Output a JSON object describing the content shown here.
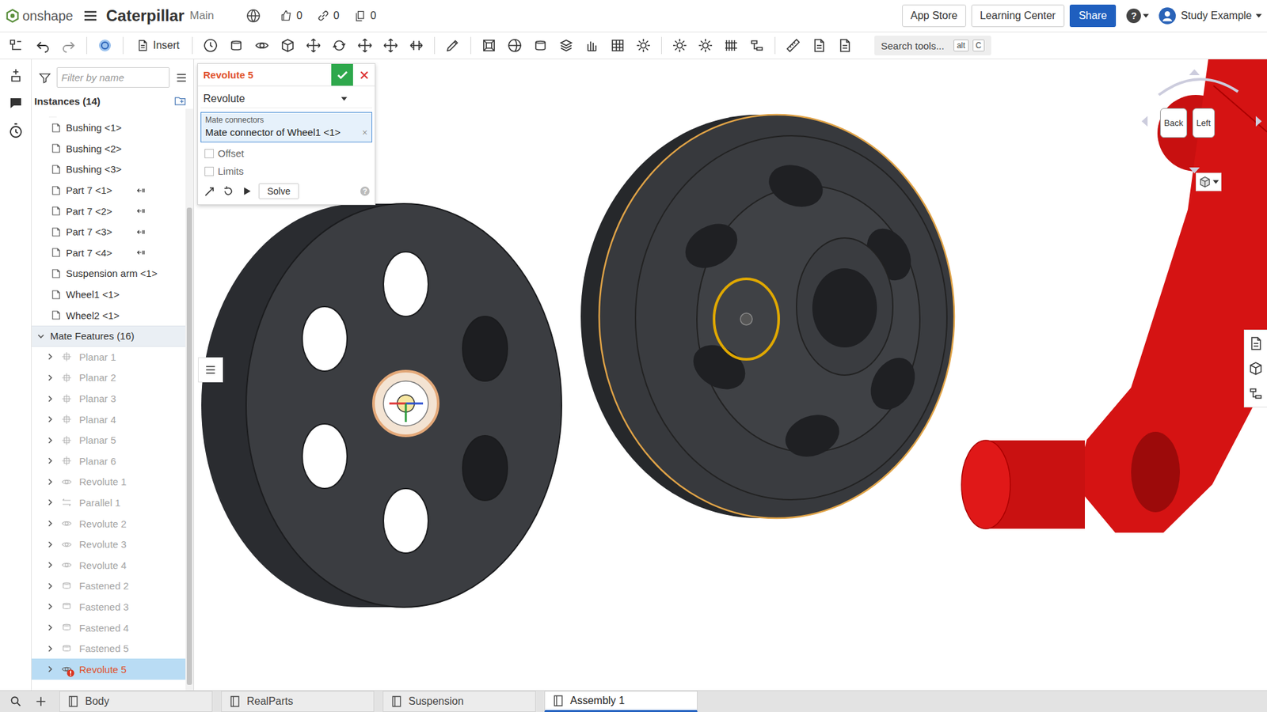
{
  "header": {
    "logo": "onshape",
    "document": "Caterpillar",
    "branch": "Main",
    "likes": "0",
    "links": "0",
    "copies": "0",
    "buttons": [
      "App Store",
      "Learning Center"
    ],
    "share": "Share",
    "help": "?",
    "user": "Study Example"
  },
  "toolbar": {
    "insert": "Insert",
    "search_placeholder": "Search tools...",
    "shortcut": [
      "alt",
      "C"
    ]
  },
  "sidebar": {
    "filter_placeholder": "Filter by name",
    "instances_title": "Instances (14)",
    "instances": [
      {
        "label": "Bushing <1>",
        "linked": false
      },
      {
        "label": "Bushing <2>",
        "linked": false
      },
      {
        "label": "Bushing <3>",
        "linked": false
      },
      {
        "label": "Part 7 <1>",
        "linked": true
      },
      {
        "label": "Part 7 <2>",
        "linked": true
      },
      {
        "label": "Part 7 <3>",
        "linked": true
      },
      {
        "label": "Part 7 <4>",
        "linked": true
      },
      {
        "label": "Suspension arm <1>",
        "linked": false
      },
      {
        "label": "Wheel1 <1>",
        "linked": false
      },
      {
        "label": "Wheel2 <1>",
        "linked": false
      }
    ],
    "mates_title": "Mate Features (16)",
    "mates_expanded": true,
    "mates": [
      {
        "label": "Planar 1",
        "kind": "planar",
        "dimmed": true,
        "selected": false,
        "error": false
      },
      {
        "label": "Planar 2",
        "kind": "planar",
        "dimmed": true,
        "selected": false,
        "error": false
      },
      {
        "label": "Planar 3",
        "kind": "planar",
        "dimmed": true,
        "selected": false,
        "error": false
      },
      {
        "label": "Planar 4",
        "kind": "planar",
        "dimmed": true,
        "selected": false,
        "error": false
      },
      {
        "label": "Planar 5",
        "kind": "planar",
        "dimmed": true,
        "selected": false,
        "error": false
      },
      {
        "label": "Planar 6",
        "kind": "planar",
        "dimmed": true,
        "selected": false,
        "error": false
      },
      {
        "label": "Revolute 1",
        "kind": "revolute",
        "dimmed": true,
        "selected": false,
        "error": false
      },
      {
        "label": "Parallel 1",
        "kind": "parallel",
        "dimmed": true,
        "selected": false,
        "error": false
      },
      {
        "label": "Revolute 2",
        "kind": "revolute",
        "dimmed": true,
        "selected": false,
        "error": false
      },
      {
        "label": "Revolute 3",
        "kind": "revolute",
        "dimmed": true,
        "selected": false,
        "error": false
      },
      {
        "label": "Revolute 4",
        "kind": "revolute",
        "dimmed": true,
        "selected": false,
        "error": false
      },
      {
        "label": "Fastened 2",
        "kind": "fastened",
        "dimmed": true,
        "selected": false,
        "error": false
      },
      {
        "label": "Fastened 3",
        "kind": "fastened",
        "dimmed": true,
        "selected": false,
        "error": false
      },
      {
        "label": "Fastened 4",
        "kind": "fastened",
        "dimmed": true,
        "selected": false,
        "error": false
      },
      {
        "label": "Fastened 5",
        "kind": "fastened",
        "dimmed": true,
        "selected": false,
        "error": false
      },
      {
        "label": "Revolute 5",
        "kind": "revolute",
        "dimmed": false,
        "selected": true,
        "error": true
      }
    ]
  },
  "dialog": {
    "title": "Revolute 5",
    "type": "Revolute",
    "field_label": "Mate connectors",
    "field_value": "Mate connector of Wheel1 <1>",
    "field_clear": "×",
    "options": [
      {
        "label": "Offset",
        "checked": false
      },
      {
        "label": "Limits",
        "checked": false
      }
    ],
    "solve": "Solve",
    "help": "?"
  },
  "view_cube": {
    "faces": [
      "Back",
      "Left"
    ]
  },
  "tabs": [
    {
      "label": "Body",
      "selected": false
    },
    {
      "label": "RealParts",
      "selected": false
    },
    {
      "label": "Suspension",
      "selected": false
    },
    {
      "label": "Assembly 1",
      "selected": true
    }
  ]
}
